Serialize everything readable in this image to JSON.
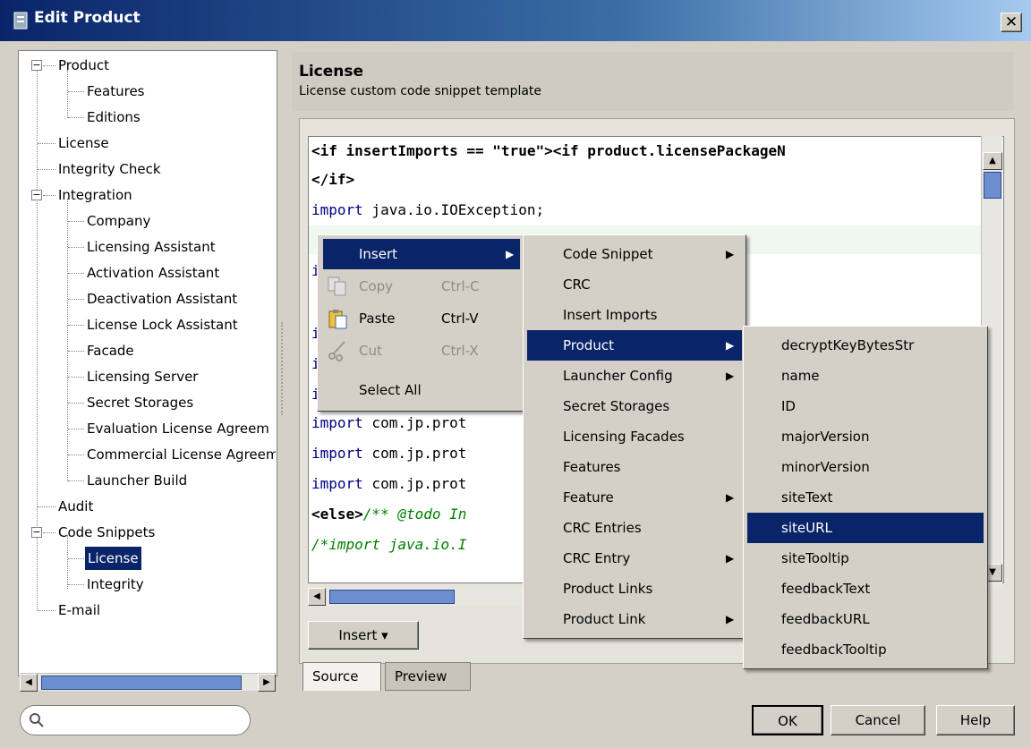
{
  "window": {
    "title": "Edit Product",
    "close": "✕"
  },
  "tree": {
    "items": [
      {
        "label": "Product",
        "level": 0,
        "expander": "−"
      },
      {
        "label": "Features",
        "level": 1
      },
      {
        "label": "Editions",
        "level": 1
      },
      {
        "label": "License",
        "level": 0
      },
      {
        "label": "Integrity Check",
        "level": 0
      },
      {
        "label": "Integration",
        "level": 0,
        "expander": "−"
      },
      {
        "label": "Company",
        "level": 1
      },
      {
        "label": "Licensing Assistant",
        "level": 1
      },
      {
        "label": "Activation Assistant",
        "level": 1
      },
      {
        "label": "Deactivation Assistant",
        "level": 1
      },
      {
        "label": "License Lock Assistant",
        "level": 1
      },
      {
        "label": "Facade",
        "level": 1
      },
      {
        "label": "Licensing Server",
        "level": 1
      },
      {
        "label": "Secret Storages",
        "level": 1
      },
      {
        "label": "Evaluation License Agreem",
        "level": 1
      },
      {
        "label": "Commercial License Agreem",
        "level": 1
      },
      {
        "label": "Launcher Build",
        "level": 1
      },
      {
        "label": "Audit",
        "level": 0
      },
      {
        "label": "Code Snippets",
        "level": 0,
        "expander": "−"
      },
      {
        "label": "License",
        "level": 1,
        "selected": true
      },
      {
        "label": "Integrity",
        "level": 1
      },
      {
        "label": "E-mail",
        "level": 0
      }
    ]
  },
  "header": {
    "title": "License",
    "subtitle": "License custom code snippet template"
  },
  "code": {
    "line1_a": "<if insertImports == \"true\"><if product.licensePackageN",
    "line2": "</if>",
    "line3_kw": "import",
    "line3_rest": " java.io.IOException;",
    "import_kw": "import",
    "import_rest": " com.jp.prot",
    "else_tag": "<else>",
    "else_rest": "/** @todo In",
    "comment_line": "/*import java.io.I",
    "partial_i": "i"
  },
  "buttons": {
    "insert": "Insert ▾",
    "ok": "OK",
    "cancel": "Cancel",
    "help": "Help"
  },
  "tabs": {
    "source": "Source",
    "preview": "Preview"
  },
  "menu1": {
    "insert": "Insert",
    "copy": "Copy",
    "copy_sc": "Ctrl-C",
    "paste": "Paste",
    "paste_sc": "Ctrl-V",
    "cut": "Cut",
    "cut_sc": "Ctrl-X",
    "select_all": "Select All"
  },
  "menu2": {
    "items": [
      "Code Snippet",
      "CRC",
      "Insert Imports",
      "Product",
      "Launcher Config",
      "Secret Storages",
      "Licensing Facades",
      "Features",
      "Feature",
      "CRC Entries",
      "CRC Entry",
      "Product Links",
      "Product Link"
    ]
  },
  "menu3": {
    "items": [
      "decryptKeyBytesStr",
      "name",
      "ID",
      "majorVersion",
      "minorVersion",
      "siteText",
      "siteURL",
      "siteTooltip",
      "feedbackText",
      "feedbackURL",
      "feedbackTooltip"
    ]
  }
}
